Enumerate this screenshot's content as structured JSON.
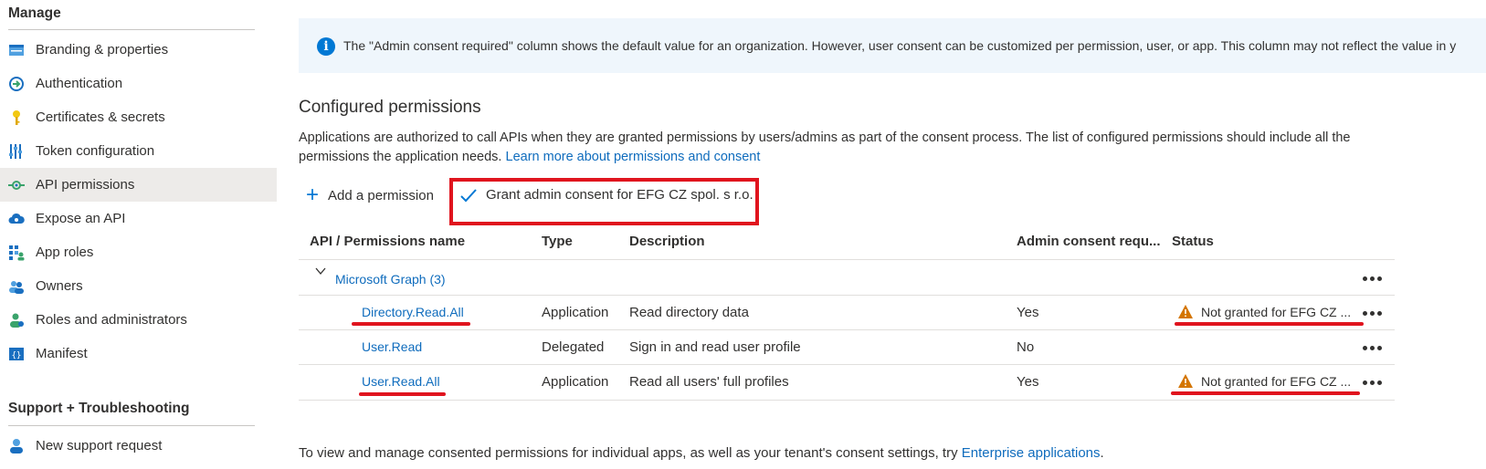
{
  "sidebar": {
    "manage_title": "Manage",
    "items": [
      {
        "label": "Branding & properties",
        "icon": "branding-icon"
      },
      {
        "label": "Authentication",
        "icon": "authentication-icon"
      },
      {
        "label": "Certificates & secrets",
        "icon": "key-icon"
      },
      {
        "label": "Token configuration",
        "icon": "token-config-icon"
      },
      {
        "label": "API permissions",
        "icon": "api-permissions-icon",
        "selected": true
      },
      {
        "label": "Expose an API",
        "icon": "cloud-icon"
      },
      {
        "label": "App roles",
        "icon": "app-roles-icon"
      },
      {
        "label": "Owners",
        "icon": "owners-icon"
      },
      {
        "label": "Roles and administrators",
        "icon": "roles-admin-icon"
      },
      {
        "label": "Manifest",
        "icon": "manifest-icon"
      }
    ],
    "support_title": "Support + Troubleshooting",
    "support_items": [
      {
        "label": "New support request",
        "icon": "support-person-icon"
      }
    ]
  },
  "info": {
    "text": "The \"Admin consent required\" column shows the default value for an organization. However, user consent can be customized per permission, user, or app. This column may not reflect the value in y"
  },
  "configured": {
    "heading": "Configured permissions",
    "description": "Applications are authorized to call APIs when they are granted permissions by users/admins as part of the consent process. The list of configured permissions should include all the permissions the application needs.",
    "learn_more": "Learn more about permissions and consent"
  },
  "toolbar": {
    "add_permission": "Add a permission",
    "grant_consent": "Grant admin consent for EFG CZ spol. s r.o."
  },
  "table": {
    "headers": {
      "name": "API / Permissions name",
      "type": "Type",
      "description": "Description",
      "admin_consent": "Admin consent requ...",
      "status": "Status"
    },
    "group": "Microsoft Graph (3)",
    "rows": [
      {
        "name": "Directory.Read.All",
        "type": "Application",
        "description": "Read directory data",
        "admin_consent": "Yes",
        "status": "Not granted for EFG CZ ..."
      },
      {
        "name": "User.Read",
        "type": "Delegated",
        "description": "Sign in and read user profile",
        "admin_consent": "No",
        "status": ""
      },
      {
        "name": "User.Read.All",
        "type": "Application",
        "description": "Read all users' full profiles",
        "admin_consent": "Yes",
        "status": "Not granted for EFG CZ ..."
      }
    ]
  },
  "footer": {
    "text": "To view and manage consented permissions for individual apps, as well as your tenant's consent settings, try",
    "link": "Enterprise applications",
    "suffix": "."
  },
  "colors": {
    "accent": "#0078d4",
    "link": "#0f6cbd",
    "annotation_red": "#e0141e",
    "warning": "#d47500",
    "info_bg": "#eff6fc",
    "selected_bg": "#edebe9"
  }
}
